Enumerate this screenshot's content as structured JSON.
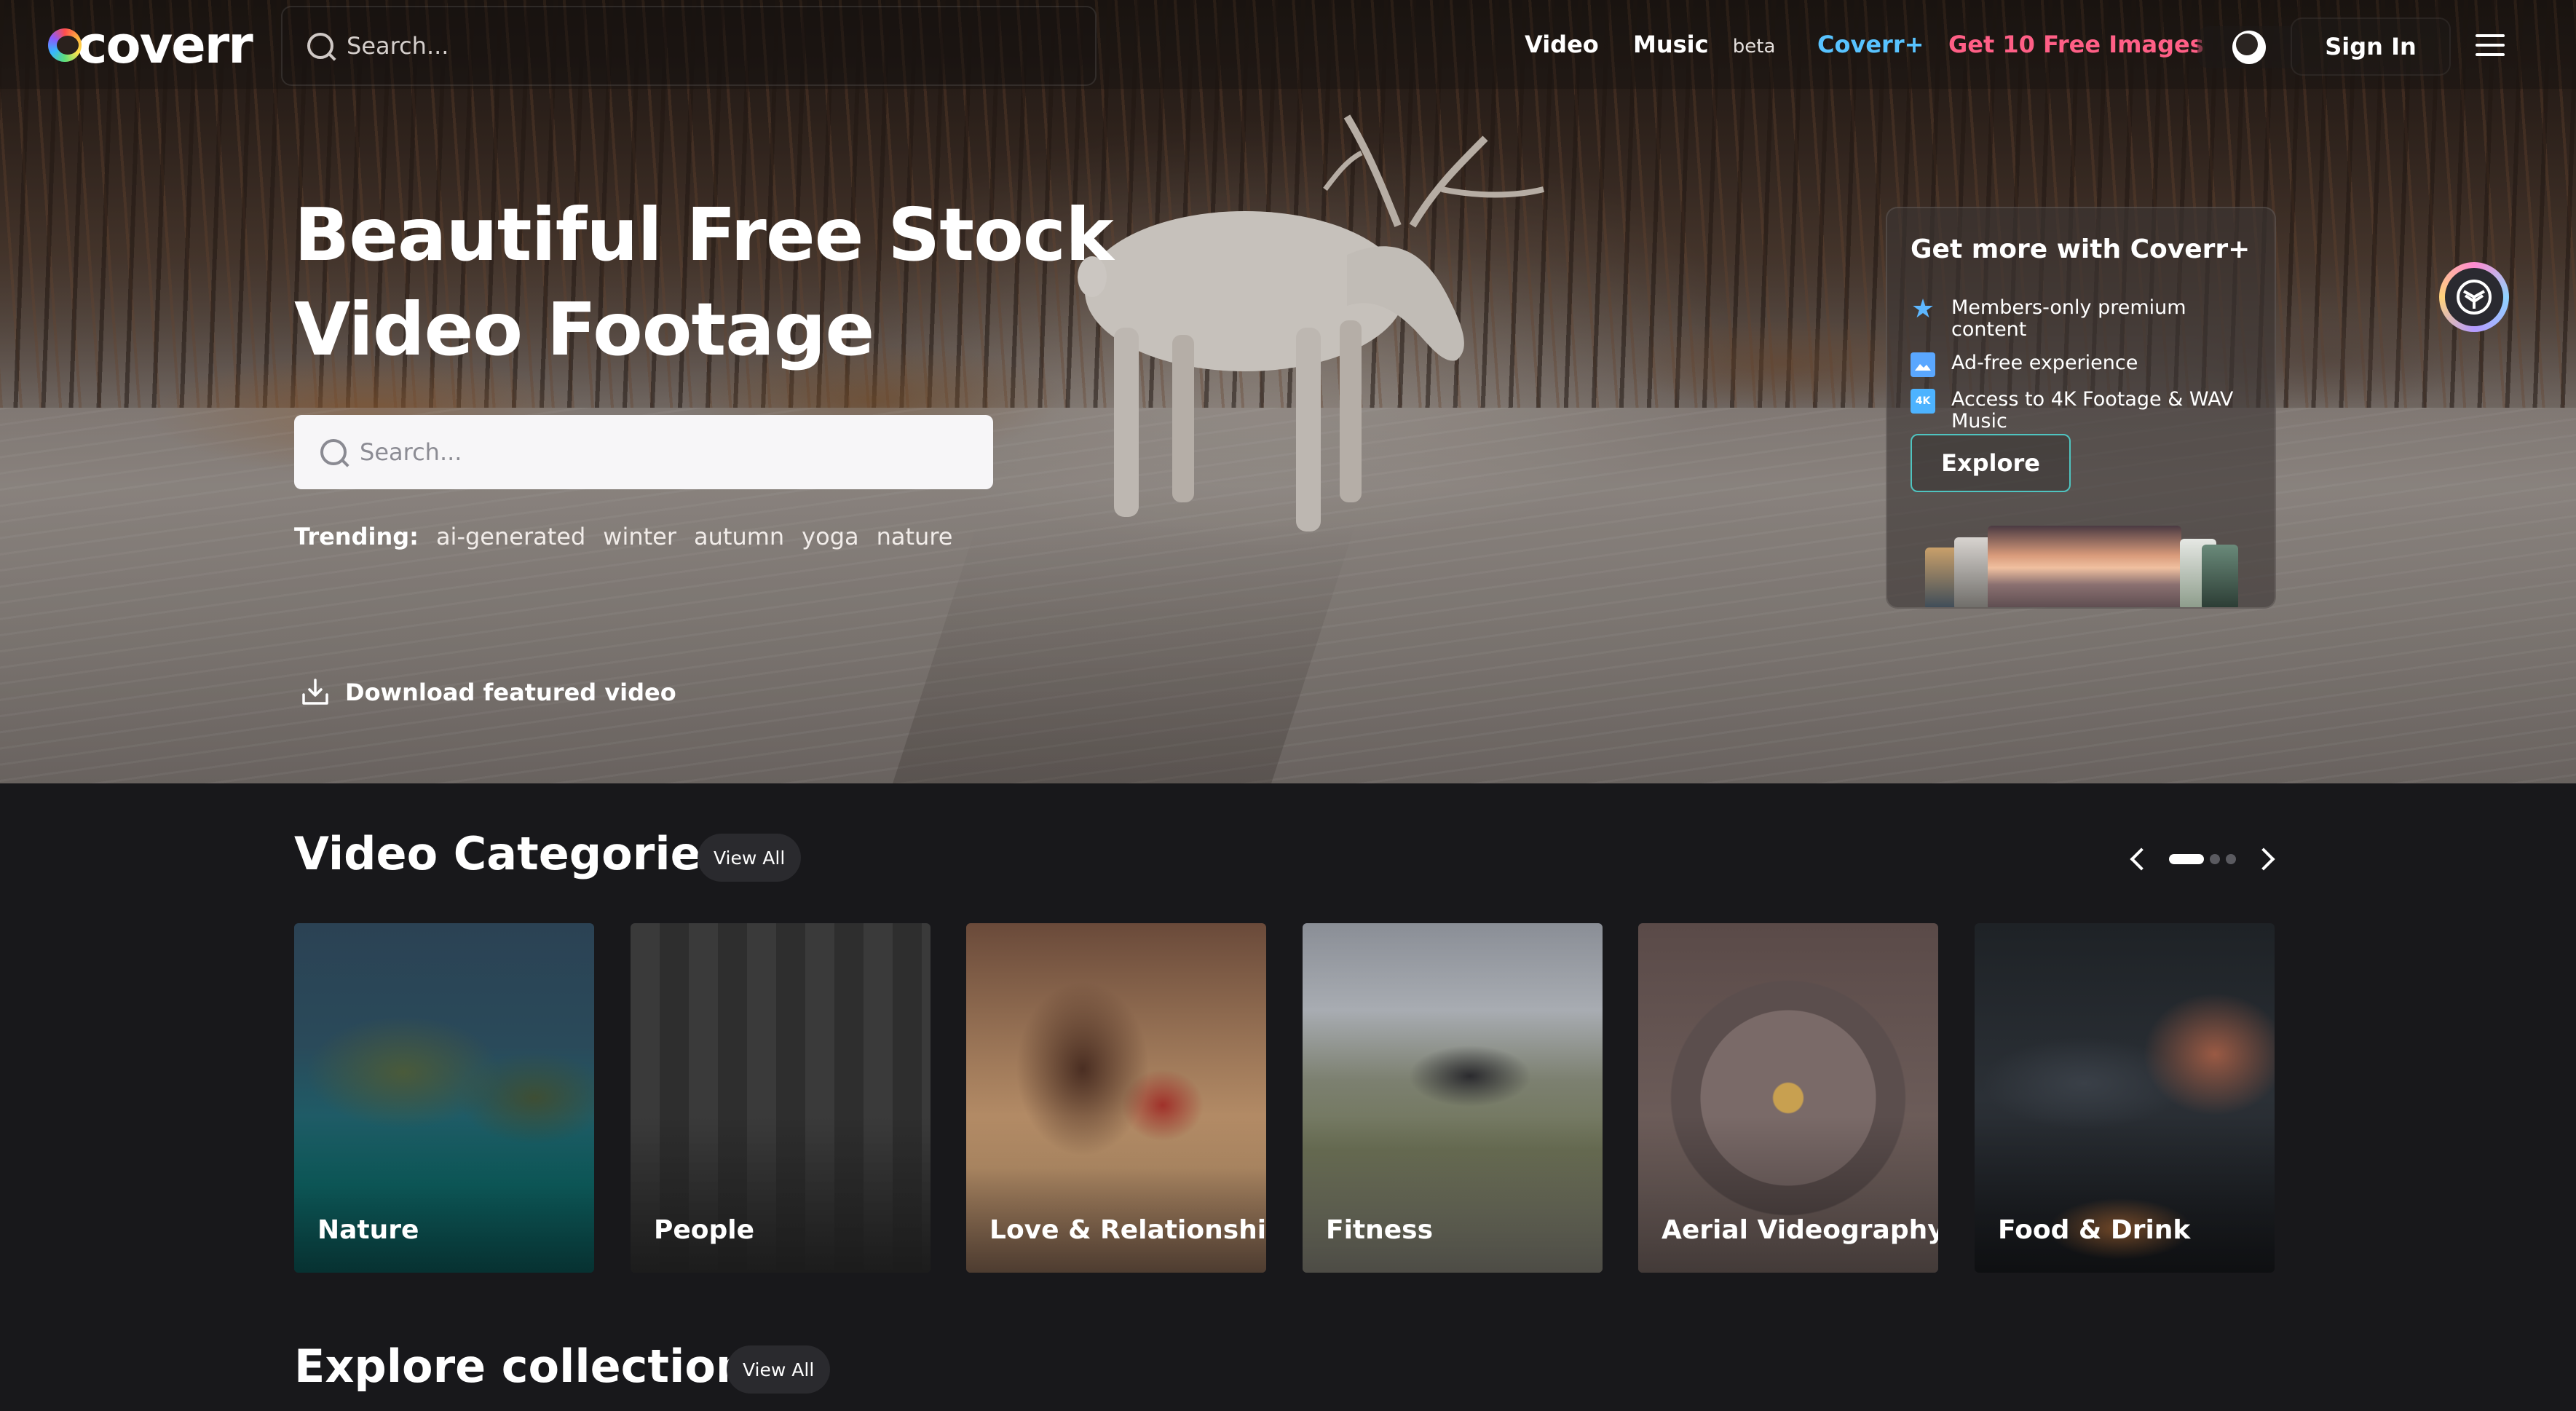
{
  "brand": {
    "name": "coverr"
  },
  "nav": {
    "search_placeholder": "Search...",
    "links": {
      "video": "Video",
      "music": "Music",
      "music_badge": "beta",
      "coverr_plus": "Coverr+",
      "free_images": "Get 10 Free Images"
    },
    "theme_toggle_icon": "moon-icon",
    "sign_in": "Sign In",
    "menu_icon": "hamburger-icon"
  },
  "hero": {
    "title": "Beautiful Free Stock Video Footage",
    "search_placeholder": "Search...",
    "trending_label": "Trending:",
    "trending": [
      "ai-generated",
      "winter",
      "autumn",
      "yoga",
      "nature"
    ],
    "download_label": "Download featured video"
  },
  "promo": {
    "title": "Get more with Coverr+",
    "features": [
      {
        "icon": "premium-star-icon",
        "label": "Members-only premium content"
      },
      {
        "icon": "ad-free-icon",
        "label": "Ad-free experience"
      },
      {
        "icon": "4k-icon",
        "icon_text": "4K",
        "label": "Access to 4K Footage & WAV Music"
      }
    ],
    "cta": "Explore"
  },
  "categories": {
    "title": "Video Categories",
    "view_all": "View All",
    "carousel": {
      "pages": 3,
      "active_page": 1
    },
    "items": [
      {
        "label": "Nature"
      },
      {
        "label": "People"
      },
      {
        "label": "Love & Relationships"
      },
      {
        "label": "Fitness"
      },
      {
        "label": "Aerial Videography"
      },
      {
        "label": "Food & Drink"
      }
    ]
  },
  "collections": {
    "title": "Explore collections",
    "view_all": "View All"
  },
  "colors": {
    "page_bg": "#18181b",
    "coverr_plus": "#58c3ff",
    "free_images": "#ff5f86",
    "explore_border": "#4fc4c0"
  }
}
